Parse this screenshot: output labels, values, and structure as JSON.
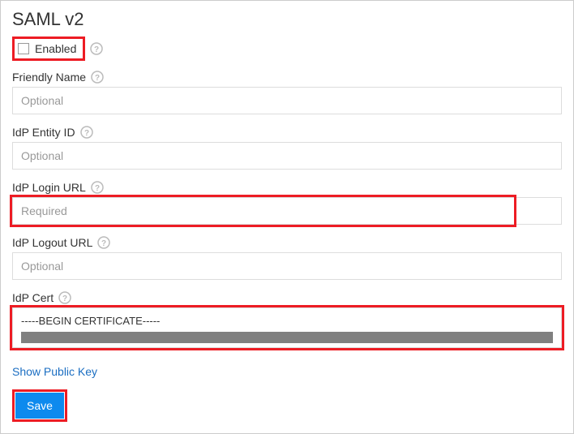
{
  "section": {
    "title": "SAML v2"
  },
  "enabled": {
    "label": "Enabled",
    "checked": false
  },
  "friendlyName": {
    "label": "Friendly Name",
    "placeholder": "Optional",
    "value": ""
  },
  "idpEntityId": {
    "label": "IdP Entity ID",
    "placeholder": "Optional",
    "value": ""
  },
  "idpLoginUrl": {
    "label": "IdP Login URL",
    "placeholder": "Required",
    "value": ""
  },
  "idpLogoutUrl": {
    "label": "IdP Logout URL",
    "placeholder": "Optional",
    "value": ""
  },
  "idpCert": {
    "label": "IdP Cert",
    "value": "-----BEGIN CERTIFICATE-----"
  },
  "publicKeyLink": {
    "label": "Show Public Key"
  },
  "saveButton": {
    "label": "Save"
  }
}
